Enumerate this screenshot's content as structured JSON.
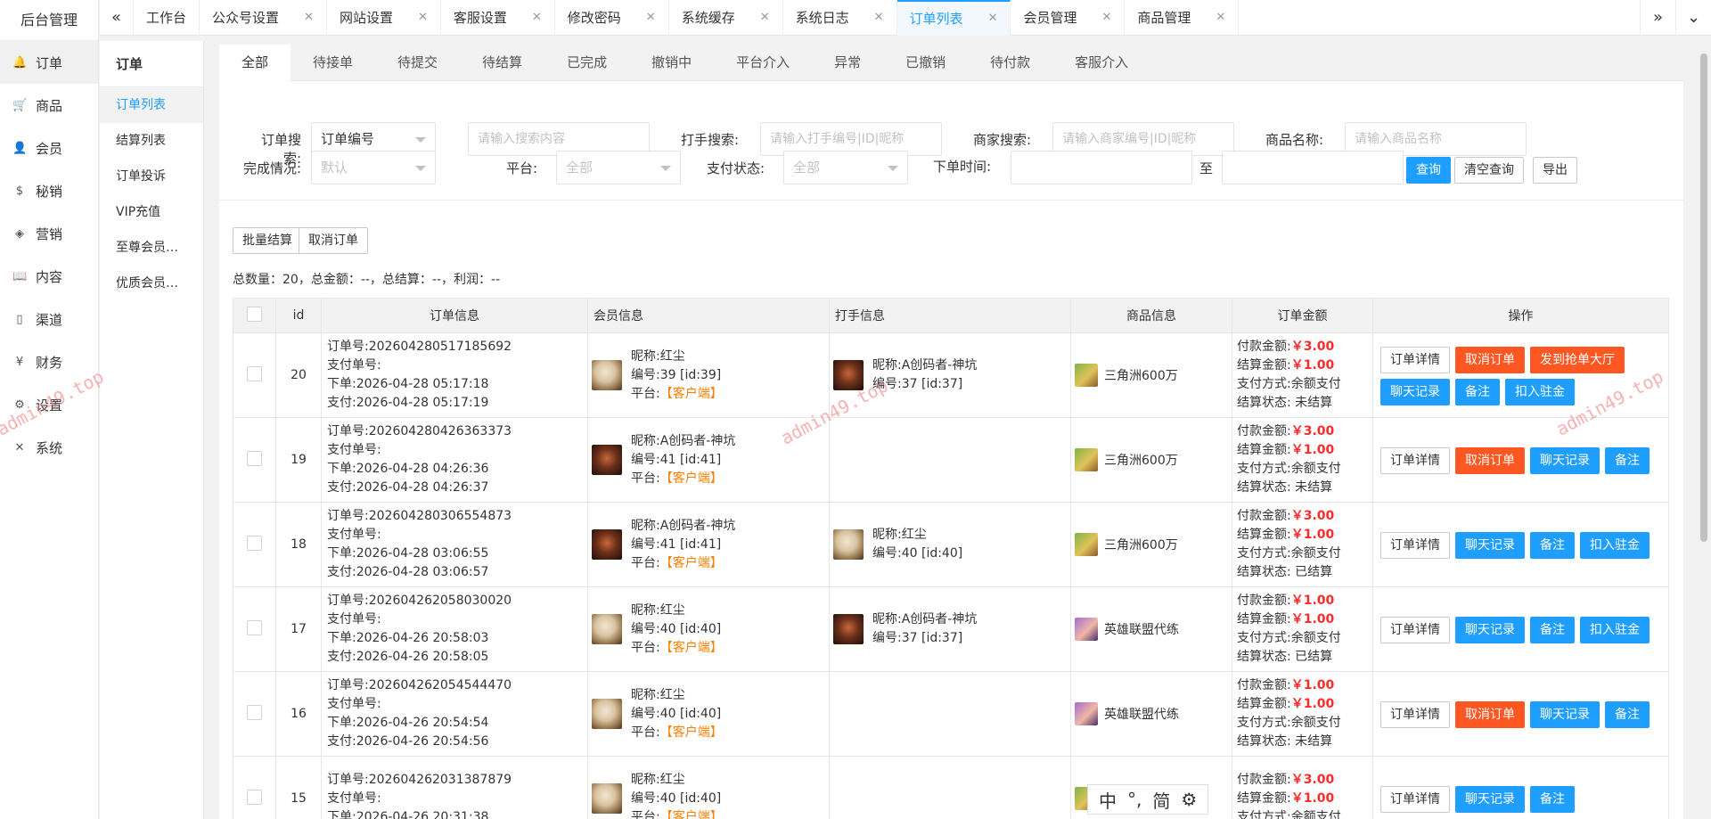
{
  "brand": "后台管理",
  "rail": [
    {
      "label": "订单",
      "icon": "bell-icon",
      "glyph": "🔔",
      "active": true
    },
    {
      "label": "商品",
      "icon": "cart-icon",
      "glyph": "🛒"
    },
    {
      "label": "会员",
      "icon": "user-icon",
      "glyph": "👤"
    },
    {
      "label": "秘销",
      "icon": "dollar-icon",
      "glyph": "$"
    },
    {
      "label": "营销",
      "icon": "cube-icon",
      "glyph": "◈"
    },
    {
      "label": "内容",
      "icon": "book-icon",
      "glyph": "📖"
    },
    {
      "label": "渠道",
      "icon": "phone-icon",
      "glyph": "▯"
    },
    {
      "label": "财务",
      "icon": "yen-icon",
      "glyph": "¥"
    },
    {
      "label": "设置",
      "icon": "gear-icon",
      "glyph": "⚙"
    },
    {
      "label": "系统",
      "icon": "tools-icon",
      "glyph": "✕"
    }
  ],
  "submenu": {
    "title": "订单",
    "items": [
      "订单列表",
      "结算列表",
      "订单投诉",
      "VIP充值",
      "至尊会员…",
      "优质会员…"
    ]
  },
  "tabs": [
    "工作台",
    "公众号设置",
    "网站设置",
    "客服设置",
    "修改密码",
    "系统缓存",
    "系统日志",
    "订单列表",
    "会员管理",
    "商品管理"
  ],
  "filter_tabs": [
    "全部",
    "待接单",
    "待提交",
    "待结算",
    "已完成",
    "撤销中",
    "平台介入",
    "异常",
    "已撤销",
    "待付款",
    "客服介入"
  ],
  "search": {
    "order_label": "订单搜索:",
    "order_select": "订单编号",
    "order_placeholder": "请输入搜索内容",
    "worker_label": "打手搜索:",
    "worker_placeholder": "请输入打手编号|ID|昵称",
    "merchant_label": "商家搜索:",
    "merchant_placeholder": "请输入商家编号|ID|昵称",
    "goods_label": "商品名称:",
    "goods_placeholder": "请输入商品名称",
    "complete_label": "完成情况:",
    "complete_select": "默认",
    "platform_label": "平台:",
    "platform_select": "全部",
    "pay_label": "支付状态:",
    "pay_select": "全部",
    "time_label": "下单时间:",
    "to_label": "至",
    "query_btn": "查询",
    "clear_btn": "清空查询",
    "export_btn": "导出"
  },
  "batch_btn": "批量结算",
  "cancel_btn": "取消订单",
  "summary": "总数量：20，总金额：--，总结算：--，利润：--",
  "columns": [
    "id",
    "订单信息",
    "会员信息",
    "打手信息",
    "商品信息",
    "订单金额",
    "操作"
  ],
  "rows": [
    {
      "id": "20",
      "order_no": "订单号:202604280517185692",
      "pay_no": "支付单号:",
      "created": "下单:2026-04-28 05:17:18",
      "paid": "支付:2026-04-28 05:17:19",
      "member": {
        "nick": "昵称:红尘",
        "num": "编号:39 [id:39]",
        "platform_label": "平台:",
        "platform": "【客户端】",
        "avatar": "cat"
      },
      "worker": {
        "nick": "昵称:A创码者-神坑",
        "num": "编号:37 [id:37]",
        "avatar": "game"
      },
      "goods": {
        "name": "三角洲600万",
        "img": "sj"
      },
      "pay_amount_label": "付款金额:",
      "pay_amount": "￥3.00",
      "settle_amount_label": "结算金额:",
      "settle_amount": "￥1.00",
      "pay_method": "支付方式:余额支付",
      "settle_status": "结算状态: 未结算",
      "ops": [
        {
          "t": "订单详情",
          "c": "white"
        },
        {
          "t": "取消订单",
          "c": "red"
        },
        {
          "t": "发到抢单大厅",
          "c": "red"
        },
        {
          "t": "聊天记录",
          "c": "blue"
        },
        {
          "t": "备注",
          "c": "blue"
        },
        {
          "t": "扣入驻金",
          "c": "blue"
        }
      ]
    },
    {
      "id": "19",
      "order_no": "订单号:202604280426363373",
      "pay_no": "支付单号:",
      "created": "下单:2026-04-28 04:26:36",
      "paid": "支付:2026-04-28 04:26:37",
      "member": {
        "nick": "昵称:A创码者-神坑",
        "num": "编号:41 [id:41]",
        "platform_label": "平台:",
        "platform": "【客户端】",
        "avatar": "game"
      },
      "worker": null,
      "goods": {
        "name": "三角洲600万",
        "img": "sj"
      },
      "pay_amount_label": "付款金额:",
      "pay_amount": "￥3.00",
      "settle_amount_label": "结算金额:",
      "settle_amount": "￥1.00",
      "pay_method": "支付方式:余额支付",
      "settle_status": "结算状态: 未结算",
      "ops": [
        {
          "t": "订单详情",
          "c": "white"
        },
        {
          "t": "取消订单",
          "c": "red"
        },
        {
          "t": "聊天记录",
          "c": "blue"
        },
        {
          "t": "备注",
          "c": "blue"
        }
      ]
    },
    {
      "id": "18",
      "order_no": "订单号:202604280306554873",
      "pay_no": "支付单号:",
      "created": "下单:2026-04-28 03:06:55",
      "paid": "支付:2026-04-28 03:06:57",
      "member": {
        "nick": "昵称:A创码者-神坑",
        "num": "编号:41 [id:41]",
        "platform_label": "平台:",
        "platform": "【客户端】",
        "avatar": "game"
      },
      "worker": {
        "nick": "昵称:红尘",
        "num": "编号:40 [id:40]",
        "avatar": "cat"
      },
      "goods": {
        "name": "三角洲600万",
        "img": "sj"
      },
      "pay_amount_label": "付款金额:",
      "pay_amount": "￥3.00",
      "settle_amount_label": "结算金额:",
      "settle_amount": "￥1.00",
      "pay_method": "支付方式:余额支付",
      "settle_status": "结算状态: 已结算",
      "ops": [
        {
          "t": "订单详情",
          "c": "white"
        },
        {
          "t": "聊天记录",
          "c": "blue"
        },
        {
          "t": "备注",
          "c": "blue"
        },
        {
          "t": "扣入驻金",
          "c": "blue"
        }
      ]
    },
    {
      "id": "17",
      "order_no": "订单号:202604262058030020",
      "pay_no": "支付单号:",
      "created": "下单:2026-04-26 20:58:03",
      "paid": "支付:2026-04-26 20:58:05",
      "member": {
        "nick": "昵称:红尘",
        "num": "编号:40 [id:40]",
        "platform_label": "平台:",
        "platform": "【客户端】",
        "avatar": "cat"
      },
      "worker": {
        "nick": "昵称:A创码者-神坑",
        "num": "编号:37 [id:37]",
        "avatar": "game"
      },
      "goods": {
        "name": "英雄联盟代练",
        "img": "lol"
      },
      "pay_amount_label": "付款金额:",
      "pay_amount": "￥1.00",
      "settle_amount_label": "结算金额:",
      "settle_amount": "￥1.00",
      "pay_method": "支付方式:余额支付",
      "settle_status": "结算状态: 已结算",
      "ops": [
        {
          "t": "订单详情",
          "c": "white"
        },
        {
          "t": "聊天记录",
          "c": "blue"
        },
        {
          "t": "备注",
          "c": "blue"
        },
        {
          "t": "扣入驻金",
          "c": "blue"
        }
      ]
    },
    {
      "id": "16",
      "order_no": "订单号:202604262054544470",
      "pay_no": "支付单号:",
      "created": "下单:2026-04-26 20:54:54",
      "paid": "支付:2026-04-26 20:54:56",
      "member": {
        "nick": "昵称:红尘",
        "num": "编号:40 [id:40]",
        "platform_label": "平台:",
        "platform": "【客户端】",
        "avatar": "cat"
      },
      "worker": null,
      "goods": {
        "name": "英雄联盟代练",
        "img": "lol"
      },
      "pay_amount_label": "付款金额:",
      "pay_amount": "￥1.00",
      "settle_amount_label": "结算金额:",
      "settle_amount": "￥1.00",
      "pay_method": "支付方式:余额支付",
      "settle_status": "结算状态: 未结算",
      "ops": [
        {
          "t": "订单详情",
          "c": "white"
        },
        {
          "t": "取消订单",
          "c": "red"
        },
        {
          "t": "聊天记录",
          "c": "blue"
        },
        {
          "t": "备注",
          "c": "blue"
        }
      ]
    },
    {
      "id": "15",
      "order_no": "订单号:202604262031387879",
      "pay_no": "支付单号:",
      "created": "下单:2026-04-26 20:31:38",
      "paid": "",
      "member": {
        "nick": "昵称:红尘",
        "num": "编号:40 [id:40]",
        "platform_label": "平台:",
        "platform": "【客户端】",
        "avatar": "cat"
      },
      "worker": null,
      "goods": {
        "name": "",
        "img": "sj"
      },
      "pay_amount_label": "付款金额:",
      "pay_amount": "￥3.00",
      "settle_amount_label": "结算金额:",
      "settle_amount": "￥1.00",
      "pay_method": "支付方式:余额支付",
      "settle_status": "",
      "ops": [
        {
          "t": "订单详情",
          "c": "white"
        },
        {
          "t": "聊天记录",
          "c": "blue"
        },
        {
          "t": "备注",
          "c": "blue"
        }
      ]
    }
  ],
  "watermark": "admin49.top",
  "ime": {
    "lang": "中",
    "punct": "°,",
    "mode": "简"
  },
  "colors": {
    "accent": "#1e9fff",
    "danger": "#ff5722",
    "platform": "#ff7f00",
    "amount": "#ff2b2b"
  }
}
